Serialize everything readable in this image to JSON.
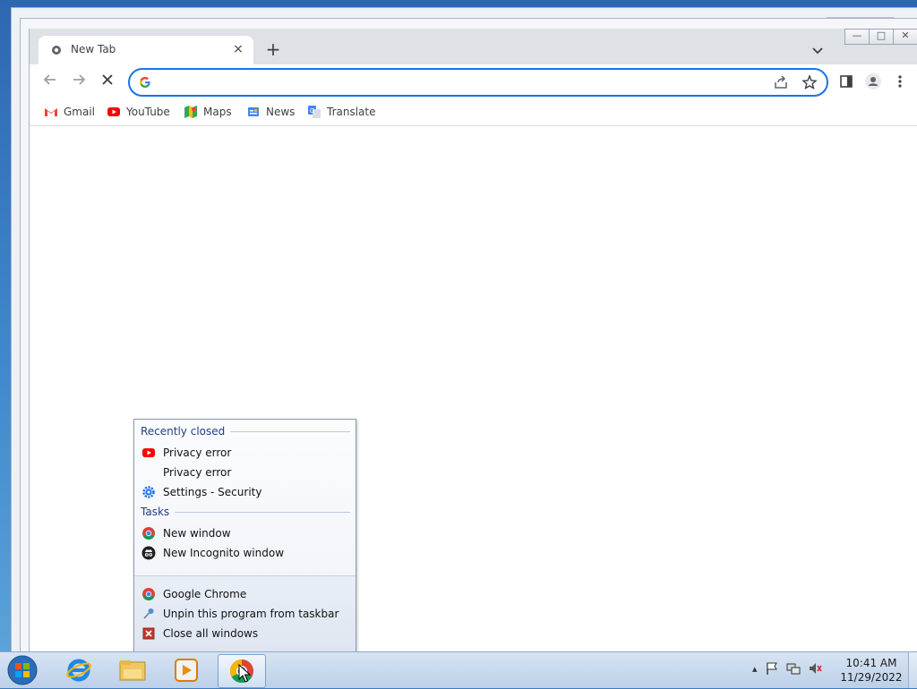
{
  "browser": {
    "tab": {
      "title": "New Tab",
      "close_label": "×"
    },
    "new_tab_label": "+",
    "window_controls": {
      "minimize": "—",
      "maximize": "□",
      "close": "✕"
    },
    "omnibox": {
      "value": "",
      "placeholder": ""
    },
    "bookmarks": [
      {
        "label": "Gmail",
        "icon": "gmail-icon"
      },
      {
        "label": "YouTube",
        "icon": "youtube-icon"
      },
      {
        "label": "Maps",
        "icon": "maps-icon"
      },
      {
        "label": "News",
        "icon": "news-icon"
      },
      {
        "label": "Translate",
        "icon": "translate-icon"
      }
    ]
  },
  "jumplist": {
    "recent_heading": "Recently closed",
    "recent_items": [
      {
        "label": "Privacy error",
        "icon": "youtube-icon"
      },
      {
        "label": "Privacy error",
        "icon": ""
      },
      {
        "label": "Settings - Security",
        "icon": "gear-icon"
      }
    ],
    "tasks_heading": "Tasks",
    "tasks": [
      {
        "label": "New window",
        "icon": "chrome-icon"
      },
      {
        "label": "New Incognito window",
        "icon": "incognito-icon"
      }
    ],
    "actions": [
      {
        "label": "Google Chrome",
        "icon": "chrome-icon"
      },
      {
        "label": "Unpin this program from taskbar",
        "icon": "unpin-icon"
      },
      {
        "label": "Close all windows",
        "icon": "close-window-icon"
      }
    ]
  },
  "taskbar": {
    "apps": [
      "internet-explorer-icon",
      "file-explorer-icon",
      "media-player-icon",
      "chrome-icon"
    ],
    "clock": {
      "time": "10:41 AM",
      "date": "11/29/2022"
    },
    "tray_arrow": "▴"
  },
  "colors": {
    "accent": "#1a73e8",
    "taskbar": "#c6d7ec",
    "jump_heading": "#1e3f8a"
  }
}
